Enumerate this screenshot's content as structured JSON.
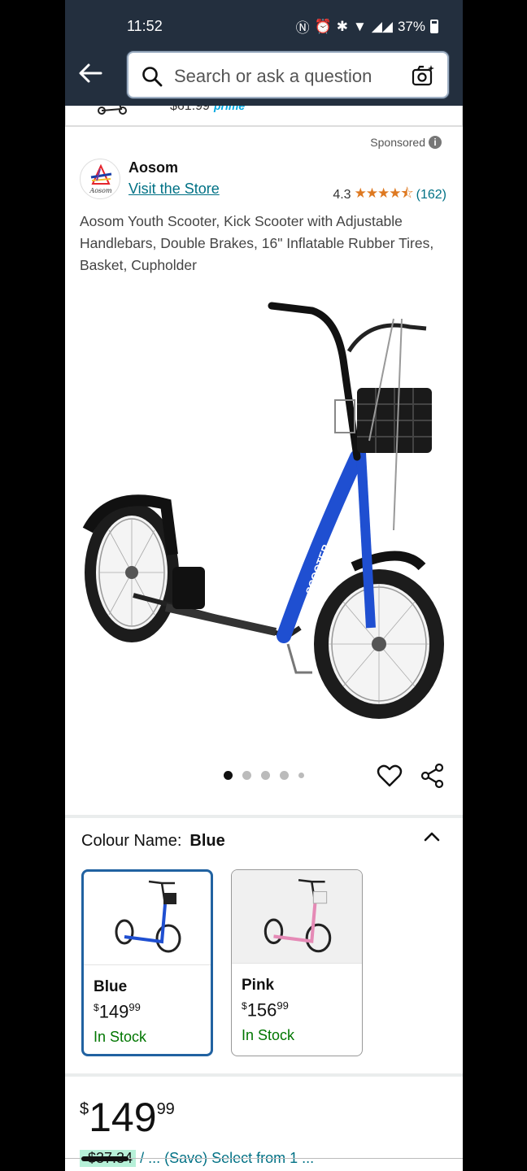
{
  "status_bar": {
    "time": "11:52",
    "battery": "37%"
  },
  "search": {
    "placeholder": "Search or ask a question"
  },
  "previous_item": {
    "price": "$61.99",
    "prime": "prime"
  },
  "sponsored_label": "Sponsored",
  "brand": {
    "name": "Aosom",
    "logo_text": "Aosom",
    "store_link": "Visit the Store"
  },
  "rating": {
    "value": "4.3",
    "stars": 4.3,
    "count": "(162)"
  },
  "product": {
    "title": "Aosom Youth Scooter, Kick Scooter with Adjustable Handlebars, Double Brakes, 16\" Inflatable Rubber Tires, Basket, Cupholder",
    "image_count": 5,
    "active_image": 0,
    "scooter_color": "#1f4fd1",
    "scooter_text": "SCOOTER"
  },
  "colour": {
    "label": "Colour Name:",
    "selected": "Blue",
    "options": [
      {
        "name": "Blue",
        "currency": "$",
        "whole": "149",
        "cents": "99",
        "stock": "In Stock",
        "color": "#1f4fd1"
      },
      {
        "name": "Pink",
        "currency": "$",
        "whole": "156",
        "cents": "99",
        "stock": "In Stock",
        "color": "#e58ab6"
      }
    ]
  },
  "price": {
    "currency": "$",
    "whole": "149",
    "cents": "99"
  },
  "cut_off_line": {
    "badge": "-$37.34",
    "text": "/ ... (Save) Select from 1 ..."
  },
  "colors": {
    "header_bg": "#232f3e",
    "link": "#007185",
    "stock": "#007600",
    "star": "#de7921",
    "selected_border": "#2162a1"
  }
}
